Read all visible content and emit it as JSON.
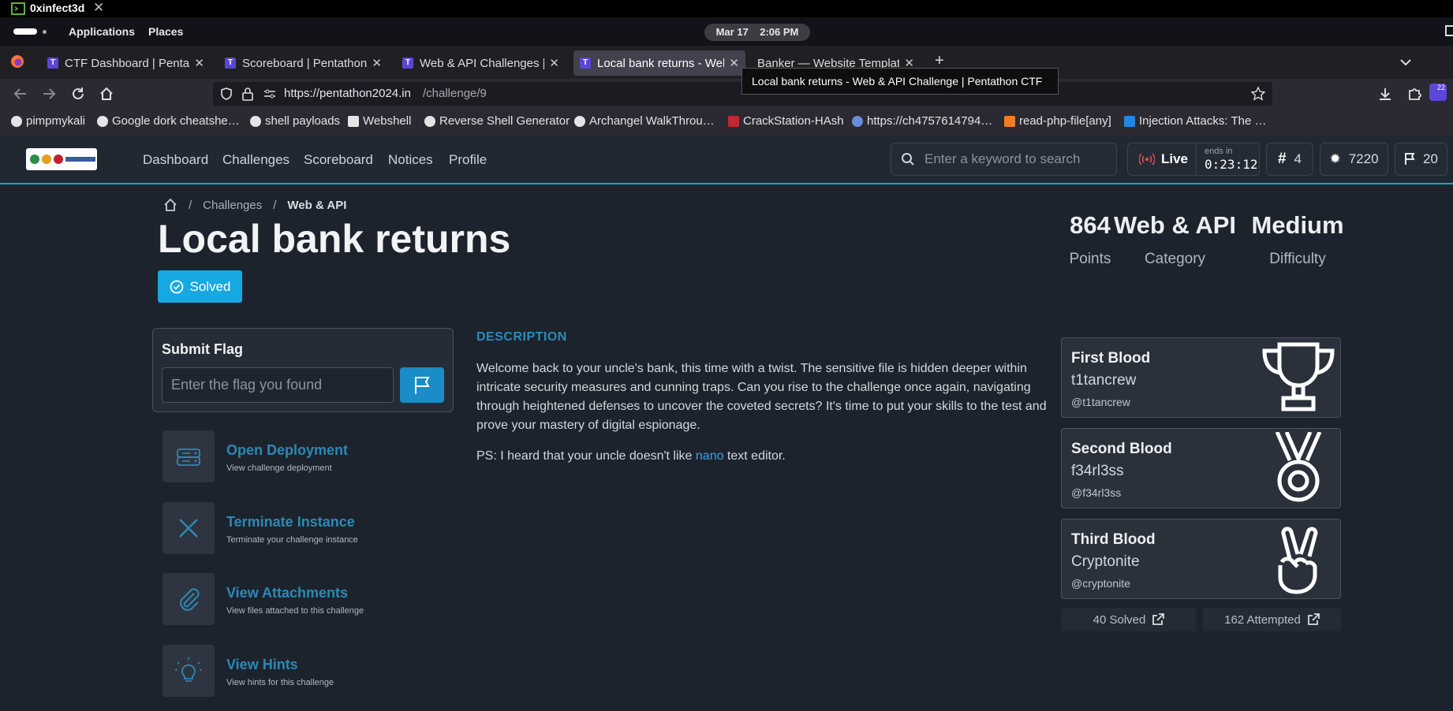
{
  "window": {
    "title": "0xinfect3d",
    "close": "✕"
  },
  "gnome": {
    "applications": "Applications",
    "places": "Places",
    "date": "Mar 17",
    "time": "2:06 PM"
  },
  "browser": {
    "tabs": [
      {
        "label": "CTF Dashboard | Pentathon"
      },
      {
        "label": "Scoreboard | Pentathon CTF"
      },
      {
        "label": "Web & API Challenges | Pentathon"
      },
      {
        "label": "Local bank returns - Web & API"
      },
      {
        "label": "Banker — Website Template"
      }
    ],
    "new_tab": "+",
    "url_host": "https://pentathon2024.in",
    "url_path": "/challenge/9",
    "tooltip": "Local bank returns - Web & API Challenge | Pentathon CTF",
    "ext_badge": "22",
    "bookmarks": [
      {
        "label": "pimpmykali",
        "color": "#e4e4e4"
      },
      {
        "label": "Google dork cheatshe…",
        "color": "#e4e4e4"
      },
      {
        "label": "shell payloads",
        "color": "#e4e4e4"
      },
      {
        "label": "Webshell",
        "color": "#e4e4e4"
      },
      {
        "label": "Reverse Shell Generator",
        "color": "#e4e4e4"
      },
      {
        "label": "Archangel WalkThrou…",
        "color": "#e4e4e4"
      },
      {
        "label": "CrackStation-HAsh",
        "color": "#c0282d"
      },
      {
        "label": "https://ch4757614794…",
        "color": "#6b8cd6"
      },
      {
        "label": "read-php-file[any]",
        "color": "#f47c20"
      },
      {
        "label": "Injection Attacks: The …",
        "color": "#1e88e5"
      }
    ]
  },
  "site": {
    "nav": [
      "Dashboard",
      "Challenges",
      "Scoreboard",
      "Notices",
      "Profile"
    ],
    "search_placeholder": "Enter a keyword to search",
    "live_label": "Live",
    "ends_in_label": "ends in",
    "countdown": "0:23:12",
    "rank": "4",
    "score": "7220",
    "flags": "20"
  },
  "breadcrumb": {
    "sep": "/",
    "challenges": "Challenges",
    "category": "Web & API"
  },
  "challenge": {
    "title": "Local bank returns",
    "solved_label": "Solved",
    "points": "864",
    "points_label": "Points",
    "category": "Web & API",
    "category_label": "Category",
    "difficulty": "Medium",
    "difficulty_label": "Difficulty",
    "description_heading": "DESCRIPTION",
    "description": "Welcome back to your uncle's bank, this time with a twist. The sensitive file is hidden deeper within intricate security measures and cunning traps. Can you rise to the challenge once again, navigating through heightened defenses to uncover the coveted secrets? It's time to put your skills to the test and prove your mastery of digital espionage.",
    "ps_before": "PS: I heard that your uncle doesn't like ",
    "ps_link": "nano",
    "ps_after": " text editor."
  },
  "flag_form": {
    "title": "Submit Flag",
    "placeholder": "Enter the flag you found"
  },
  "actions": [
    {
      "title": "Open Deployment",
      "desc": "View challenge deployment",
      "icon": "server-icon"
    },
    {
      "title": "Terminate Instance",
      "desc": "Terminate your challenge instance",
      "icon": "close-icon"
    },
    {
      "title": "View Attachments",
      "desc": "View files attached to this challenge",
      "icon": "paperclip-icon"
    },
    {
      "title": "View Hints",
      "desc": "View hints for this challenge",
      "icon": "lightbulb-icon"
    }
  ],
  "bloods": [
    {
      "title": "First Blood",
      "team": "t1tancrew",
      "handle": "@t1tancrew",
      "icon": "trophy-icon"
    },
    {
      "title": "Second Blood",
      "team": "f34rl3ss",
      "handle": "@f34rl3ss",
      "icon": "medal-icon"
    },
    {
      "title": "Third Blood",
      "team": "Cryptonite",
      "handle": "@cryptonite",
      "icon": "peace-hand-icon"
    }
  ],
  "stats": {
    "solved": "40 Solved",
    "attempted": "162 Attempted"
  }
}
